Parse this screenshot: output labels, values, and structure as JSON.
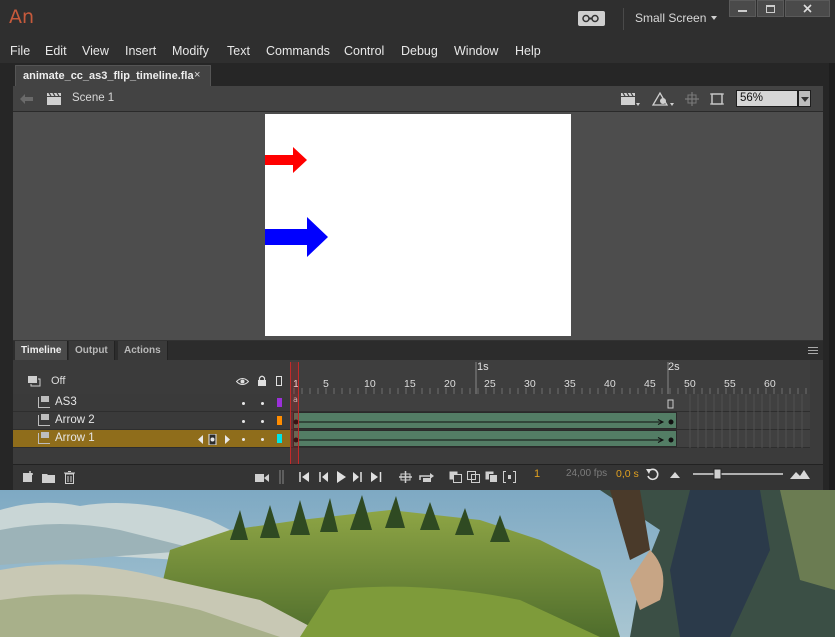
{
  "app": {
    "logo": "An",
    "workspace_label": "Small Screen"
  },
  "menu": [
    "File",
    "Edit",
    "View",
    "Insert",
    "Modify",
    "Text",
    "Commands",
    "Control",
    "Debug",
    "Window",
    "Help"
  ],
  "document_tab": {
    "filename": "animate_cc_as3_flip_timeline.fla",
    "close_glyph": "×"
  },
  "editbar": {
    "scene": "Scene 1",
    "zoom": "56%"
  },
  "stage": {
    "background": "#ffffff",
    "arrows": [
      {
        "name": "Arrow 2",
        "color": "#ff0000"
      },
      {
        "name": "Arrow 1",
        "color": "#0000ff"
      }
    ]
  },
  "panel_tabs": [
    "Timeline",
    "Output",
    "Actions"
  ],
  "timeline": {
    "layer_header": "Off",
    "second_markers": [
      "1s",
      "2s"
    ],
    "frame_numbers": [
      "1",
      "5",
      "10",
      "15",
      "20",
      "25",
      "30",
      "35",
      "40",
      "45",
      "50",
      "55",
      "60"
    ],
    "layers": [
      {
        "name": "AS3",
        "color": "#9b30d9",
        "active": false
      },
      {
        "name": "Arrow 2",
        "color": "#ff8c00",
        "active": false
      },
      {
        "name": "Arrow 1",
        "color": "#00e5e5",
        "active": true
      }
    ],
    "current_frame": "1",
    "fps": "24,00 fps",
    "elapsed": "0,0 s"
  }
}
